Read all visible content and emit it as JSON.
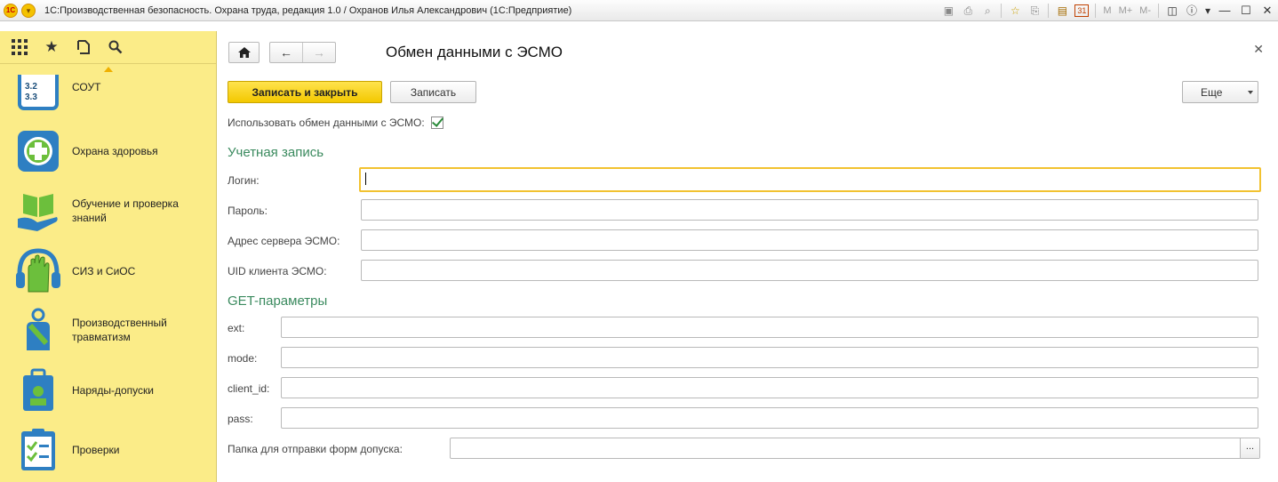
{
  "window": {
    "title": "1С:Производственная безопасность. Охрана труда, редакция 1.0 / Охранов Илья Александрович  (1С:Предприятие)",
    "logo_text": "1C",
    "memory_buttons": [
      "M",
      "M+",
      "M-"
    ],
    "calendar_day": "31"
  },
  "sidebar": {
    "items": [
      {
        "label": "СОУТ",
        "icon": "checklist-3-icon"
      },
      {
        "label": "Охрана здоровья",
        "icon": "health-cross-icon"
      },
      {
        "label": "Обучение и проверка знаний",
        "icon": "book-hand-icon"
      },
      {
        "label": "СИЗ и СиОС",
        "icon": "gloves-headphones-icon"
      },
      {
        "label": "Производственный травматизм",
        "icon": "injured-person-icon"
      },
      {
        "label": "Наряды-допуски",
        "icon": "permit-badge-icon"
      },
      {
        "label": "Проверки",
        "icon": "clipboard-check-icon"
      }
    ],
    "soyt_icon_text": "3.2 3.3"
  },
  "form": {
    "title": "Обмен данными с ЭСМО",
    "buttons": {
      "save_close": "Записать и закрыть",
      "save": "Записать",
      "more": "Еще"
    },
    "use_exchange_label": "Использовать обмен данными с ЭСМО:",
    "use_exchange_checked": true,
    "account_section": "Учетная запись",
    "account_fields": [
      {
        "label": "Логин:",
        "value": ""
      },
      {
        "label": "Пароль:",
        "value": ""
      },
      {
        "label": "Адрес сервера ЭСМО:",
        "value": ""
      },
      {
        "label": "UID клиента ЭСМО:",
        "value": ""
      }
    ],
    "get_section": "GET-параметры",
    "get_fields": [
      {
        "label": "ext:",
        "value": ""
      },
      {
        "label": "mode:",
        "value": ""
      },
      {
        "label": "client_id:",
        "value": ""
      },
      {
        "label": "pass:",
        "value": ""
      }
    ],
    "folder_label": "Папка для отправки форм допуска:",
    "folder_value": "",
    "folder_select": "..."
  },
  "colors": {
    "sidebar_bg": "#fbec88",
    "section_header": "#3a8a5e",
    "primary_button": "#f3c800",
    "icon_blue": "#2e7fc2"
  }
}
